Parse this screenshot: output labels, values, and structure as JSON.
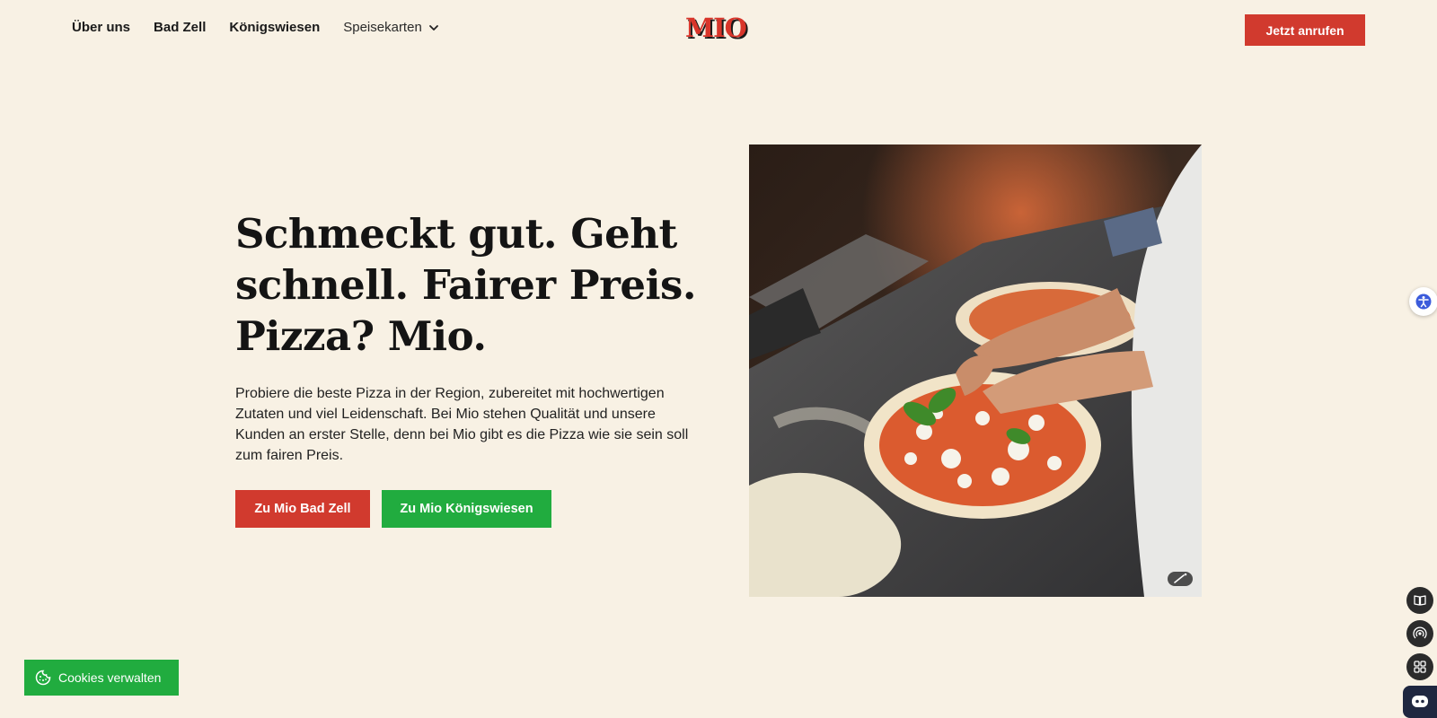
{
  "nav": {
    "items": [
      {
        "label": "Über uns"
      },
      {
        "label": "Bad Zell"
      },
      {
        "label": "Königswiesen"
      }
    ],
    "dropdown_label": "Speisekarten"
  },
  "logo": {
    "text": "MIO"
  },
  "header": {
    "call_label": "Jetzt anrufen"
  },
  "hero": {
    "headline": "Schmeckt gut. Geht schnell. Fairer Preis. Pizza? Mio.",
    "intro": "Probiere die beste Pizza in der Region, zubereitet mit hochwertigen Zutaten und viel Leidenschaft. Bei Mio stehen Qualität und unsere Kunden an erster Stelle, denn bei Mio gibt es die Pizza wie sie sein soll zum fairen Preis.",
    "buttons": {
      "bad_zell": "Zu Mio Bad Zell",
      "koenigswiesen": "Zu Mio Königswiesen"
    }
  },
  "cookies": {
    "label": "Cookies verwalten"
  },
  "colors": {
    "background": "#f8f1e4",
    "brand_red": "#d13a2e",
    "brand_green": "#21ac3f"
  },
  "icons": {
    "dropdown": "chevron-down-icon",
    "cookie": "cookie-icon",
    "accessibility": "accessibility-icon",
    "book": "book-icon",
    "broadcast": "broadcast-icon",
    "apps": "apps-grid-icon",
    "chat": "chat-bot-icon",
    "image_edit": "magic-wand-icon"
  }
}
